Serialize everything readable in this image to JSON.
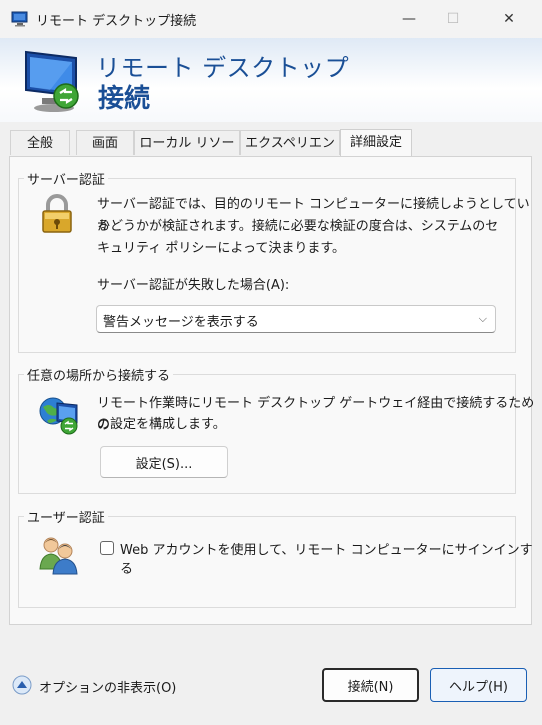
{
  "window": {
    "title": "リモート デスクトップ接続",
    "minimize": "—",
    "maximize": "☐",
    "close": "✕"
  },
  "banner": {
    "line1": "リモート デスクトップ",
    "line2": "接続"
  },
  "tabs": [
    {
      "label": "全般"
    },
    {
      "label": "画面"
    },
    {
      "label": "ローカル リソース"
    },
    {
      "label": "エクスペリエンス"
    },
    {
      "label": "詳細設定"
    }
  ],
  "server_auth": {
    "title": "サーバー認証",
    "desc_line1": "サーバー認証では、目的のリモート コンピューターに接続しようとしている",
    "desc_line2": "かどうかが検証されます。接続に必要な検証の度合は、システムのセ",
    "desc_line3": "キュリティ ポリシーによって決まります。",
    "fail_label": "サーバー認証が失敗した場合(A):",
    "fail_value": "警告メッセージを表示する"
  },
  "connect_anywhere": {
    "title": "任意の場所から接続する",
    "desc_line1": "リモート作業時にリモート デスクトップ ゲートウェイ経由で接続するための",
    "desc_line2": "の設定を構成します。",
    "settings_button": "設定(S)..."
  },
  "user_auth": {
    "title": "ユーザー認証",
    "checkbox_label": "Web アカウントを使用して、リモート コンピューターにサインインする"
  },
  "footer": {
    "options_toggle": "オプションの非表示(O)",
    "connect_button": "接続(N)",
    "help_button": "ヘルプ(H)"
  }
}
